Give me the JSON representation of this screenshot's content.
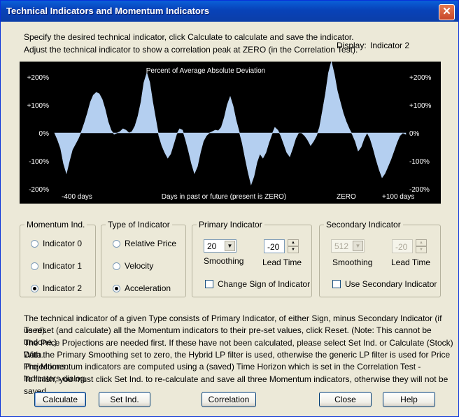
{
  "window": {
    "title": "Technical Indicators and Momentum Indicators",
    "close_symbol": "✕"
  },
  "intro": {
    "line1": "Specify the desired technical indicator, click Calculate to calculate and save the indicator.",
    "line2": "Adjust the technical indicator to show a correlation peak at ZERO (in the Correlation Test).",
    "display_label": "Display:",
    "display_value": "Indicator 2"
  },
  "chart_data": {
    "type": "area",
    "title": "Percent of Average Absolute Deviation",
    "xlabel": "Days in past or future (present is ZERO)",
    "x_markers": [
      "-400 days",
      "ZERO",
      "+100 days"
    ],
    "yticks": [
      "+200%",
      "+100%",
      "0%",
      "-100%",
      "-200%"
    ],
    "ylim": [
      -200,
      250
    ],
    "colors": {
      "background": "#000000",
      "fill": "#b4cff0",
      "text": "#ffffff"
    },
    "series": [
      {
        "values": [
          0,
          -25,
          -55,
          -110,
          -145,
          -100,
          -60,
          -40,
          -20,
          5,
          35,
          70,
          110,
          135,
          145,
          140,
          120,
          85,
          40,
          10,
          -5,
          0,
          5,
          15,
          10,
          0,
          5,
          25,
          60,
          110,
          180,
          215,
          180,
          110,
          50,
          -10,
          -45,
          -70,
          -90,
          -75,
          -40,
          -5,
          15,
          10,
          -25,
          -65,
          -110,
          -145,
          -120,
          -70,
          -30,
          -10,
          0,
          5,
          10,
          8,
          20,
          55,
          100,
          130,
          95,
          45,
          5,
          -35,
          -90,
          -140,
          -185,
          -155,
          -105,
          -75,
          -90,
          -70,
          -35,
          -5,
          20,
          10,
          -10,
          -40,
          -70,
          -85,
          -55,
          -20,
          0,
          0,
          -10,
          -25,
          -45,
          -30,
          -10,
          20,
          80,
          140,
          215,
          260,
          210,
          150,
          110,
          70,
          40,
          15,
          -5,
          -30,
          -65,
          -50,
          -20,
          0,
          -20,
          -55,
          -95,
          -130,
          -160,
          -145,
          -120,
          -95,
          -65,
          -35,
          -10,
          0,
          -5
        ]
      }
    ]
  },
  "momentum_group": {
    "title": "Momentum Ind.",
    "options": [
      "Indicator 0",
      "Indicator 1",
      "Indicator 2"
    ],
    "selected": "Indicator 2"
  },
  "type_group": {
    "title": "Type of Indicator",
    "options": [
      "Relative Price",
      "Velocity",
      "Acceleration"
    ],
    "selected": "Acceleration"
  },
  "primary_group": {
    "title": "Primary Indicator",
    "smoothing_value": "20",
    "smoothing_label": "Smoothing",
    "lead_value": "-20",
    "lead_label": "Lead Time",
    "change_sign_label": "Change Sign of Indicator"
  },
  "secondary_group": {
    "title": "Secondary Indicator",
    "smoothing_value": "512",
    "smoothing_label": "Smoothing",
    "lead_value": "-20",
    "lead_label": "Lead Time",
    "use_label": "Use Secondary Indicator"
  },
  "description": [
    "The technical indicator of a given Type consists of Primary Indicator, of either Sign, minus Secondary Indicator (if used).",
    "To reset (and calculate) all the Momentum indicators to their pre-set values, click Reset.  (Note: This cannot be undone.)",
    "The Price Projections are needed first. If these have not been calculated, please select Set Ind. or Calculate (Stock) Data.",
    "With the Primary Smoothing set to zero, the Hybrid LP filter is used, otherwise the generic LP filter is used for Price Projections.",
    "The Momentum indicators are computed using a (saved) Time Horizon which is set in the Correlation Test - Indicators dialog.",
    "To finish, you must click Set Ind. to re-calculate and save all three Momentum indicators, otherwise they will not be saved."
  ],
  "buttons": {
    "calculate": "Calculate",
    "set_ind": "Set Ind.",
    "correlation": "Correlation",
    "close": "Close",
    "help": "Help"
  }
}
